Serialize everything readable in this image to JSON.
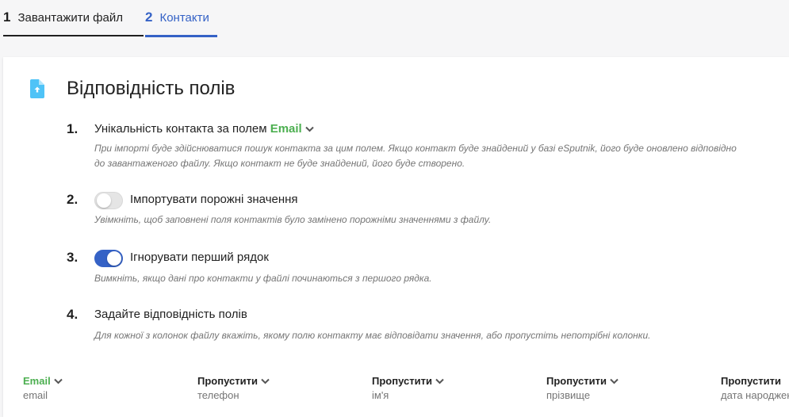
{
  "tabs": [
    {
      "num": "1",
      "label": "Завантажити файл"
    },
    {
      "num": "2",
      "label": "Контакти"
    }
  ],
  "card": {
    "title": "Відповідність полів"
  },
  "steps": {
    "s1": {
      "num": "1.",
      "label_prefix": "Унікальність контакта за полем",
      "field": "Email",
      "desc": "При імпорті буде здійснюватися пошук контакта за цим полем. Якщо контакт буде знайдений у базі eSputnik, його буде оновлено відповідно до завантаженого файлу. Якщо контакт не буде знайдений, його буде створено."
    },
    "s2": {
      "num": "2.",
      "label": "Імпортувати порожні значення",
      "enabled": false,
      "desc": "Увімкніть, щоб заповнені поля контактів було замінено порожніми значеннями з файлу."
    },
    "s3": {
      "num": "3.",
      "label": "Ігнорувати перший рядок",
      "enabled": true,
      "desc": "Вимкніть, якщо дані про контакти у файлі починаються з першого рядка."
    },
    "s4": {
      "num": "4.",
      "label": "Задайте відповідність полів",
      "desc": "Для кожної з колонок файлу вкажіть, якому полю контакту має відповідати значення, або пропустіть непотрібні колонки."
    }
  },
  "mapping": [
    {
      "field": "Email",
      "column": "email"
    },
    {
      "field": "Пропустити",
      "column": "телефон"
    },
    {
      "field": "Пропустити",
      "column": "ім'я"
    },
    {
      "field": "Пропустити",
      "column": "прізвище"
    },
    {
      "field": "Пропустити",
      "column": "дата народження"
    }
  ],
  "colors": {
    "accent": "#3562c6",
    "green": "#4caf50",
    "icon": "#4fc3f7"
  }
}
